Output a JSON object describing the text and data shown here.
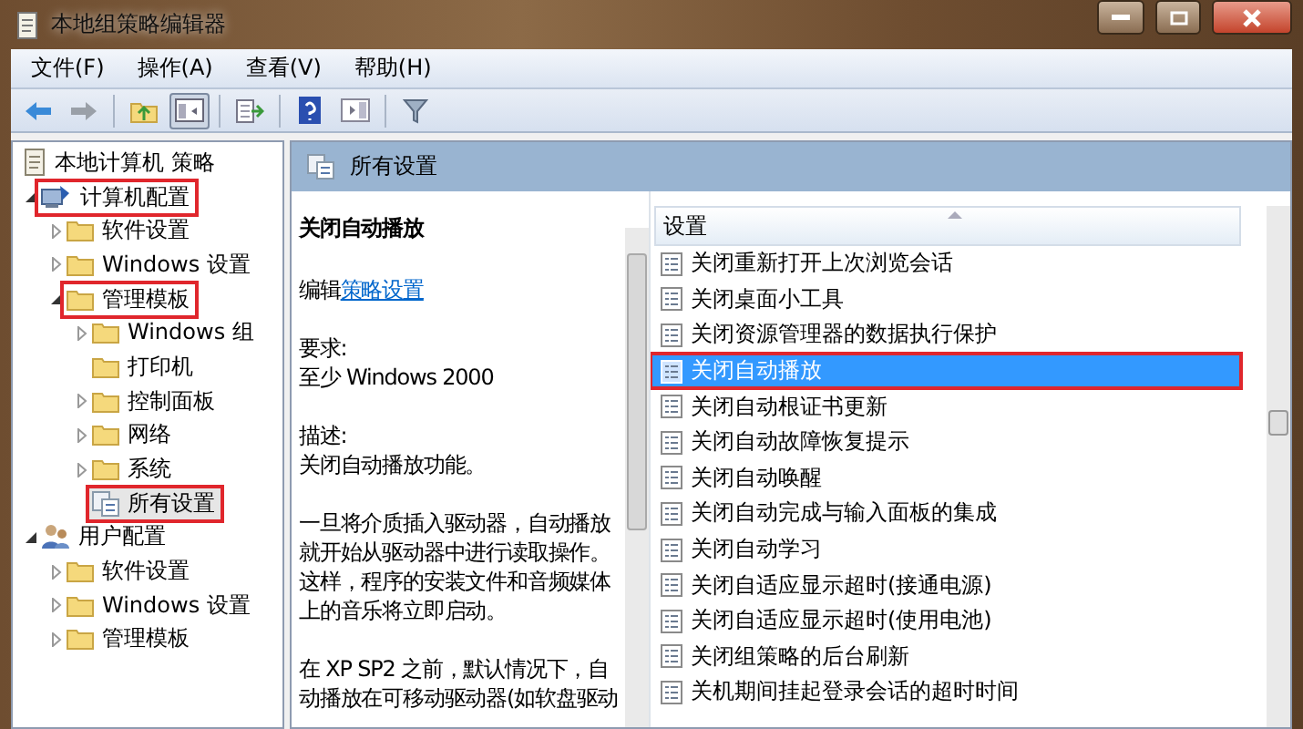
{
  "window": {
    "title": "本地组策略编辑器"
  },
  "menu": [
    {
      "label": "文件(F)"
    },
    {
      "label": "操作(A)"
    },
    {
      "label": "查看(V)"
    },
    {
      "label": "帮助(H)"
    }
  ],
  "tree": [
    {
      "label": "本地计算机 策略",
      "kind": "policy",
      "annotated": false,
      "selected": false,
      "children": [
        {
          "label": "计算机配置",
          "kind": "computer",
          "expanded": true,
          "annotated": true,
          "selected": false,
          "children": [
            {
              "label": "软件设置",
              "kind": "folder",
              "expanded": false,
              "annotated": false,
              "selected": false
            },
            {
              "label": "Windows 设置",
              "kind": "folder",
              "expanded": false,
              "annotated": false,
              "selected": false
            },
            {
              "label": "管理模板",
              "kind": "folder",
              "expanded": true,
              "annotated": true,
              "selected": false,
              "children": [
                {
                  "label": "Windows 组",
                  "kind": "folder",
                  "expanded": false,
                  "annotated": false,
                  "selected": false
                },
                {
                  "label": "打印机",
                  "kind": "folder",
                  "annotated": false,
                  "selected": false
                },
                {
                  "label": "控制面板",
                  "kind": "folder",
                  "expanded": false,
                  "annotated": false,
                  "selected": false
                },
                {
                  "label": "网络",
                  "kind": "folder",
                  "expanded": false,
                  "annotated": false,
                  "selected": false
                },
                {
                  "label": "系统",
                  "kind": "folder",
                  "expanded": false,
                  "annotated": false,
                  "selected": false
                },
                {
                  "label": "所有设置",
                  "kind": "settings",
                  "annotated": true,
                  "selected": true
                }
              ]
            }
          ]
        },
        {
          "label": "用户配置",
          "kind": "user",
          "expanded": true,
          "annotated": false,
          "selected": false,
          "children": [
            {
              "label": "软件设置",
              "kind": "folder",
              "expanded": false,
              "annotated": false,
              "selected": false
            },
            {
              "label": "Windows 设置",
              "kind": "folder",
              "expanded": false,
              "annotated": false,
              "selected": false
            },
            {
              "label": "管理模板",
              "kind": "folder",
              "expanded": false,
              "annotated": false,
              "selected": false
            }
          ]
        }
      ]
    }
  ],
  "pane_header": {
    "title": "所有设置"
  },
  "description": {
    "title": "关闭自动播放",
    "edit_prefix": "编辑",
    "edit_link": "策略设置",
    "requirement_label": "要求:",
    "requirement": "至少 Windows 2000",
    "description_label": "描述:",
    "summary": "关闭自动播放功能。",
    "paragraphs": [
      "一旦将介质插入驱动器，自动播放就开始从驱动器中进行读取操作。这样，程序的安装文件和音频媒体上的音乐将立即启动。",
      "在 XP SP2 之前，默认情况下，自动播放在可移动驱动器(如软盘驱动"
    ]
  },
  "settings_list": {
    "column": "设置",
    "rows": [
      {
        "label": "关闭重新打开上次浏览会话",
        "selected": false,
        "annotated": false
      },
      {
        "label": "关闭桌面小工具",
        "selected": false,
        "annotated": false
      },
      {
        "label": "关闭资源管理器的数据执行保护",
        "selected": false,
        "annotated": false
      },
      {
        "label": "关闭自动播放",
        "selected": true,
        "annotated": true
      },
      {
        "label": "关闭自动根证书更新",
        "selected": false,
        "annotated": false
      },
      {
        "label": "关闭自动故障恢复提示",
        "selected": false,
        "annotated": false
      },
      {
        "label": "关闭自动唤醒",
        "selected": false,
        "annotated": false
      },
      {
        "label": "关闭自动完成与输入面板的集成",
        "selected": false,
        "annotated": false
      },
      {
        "label": "关闭自动学习",
        "selected": false,
        "annotated": false
      },
      {
        "label": "关闭自适应显示超时(接通电源)",
        "selected": false,
        "annotated": false
      },
      {
        "label": "关闭自适应显示超时(使用电池)",
        "selected": false,
        "annotated": false
      },
      {
        "label": "关闭组策略的后台刷新",
        "selected": false,
        "annotated": false
      },
      {
        "label": "关机期间挂起登录会话的超时时间",
        "selected": false,
        "annotated": false
      }
    ]
  }
}
